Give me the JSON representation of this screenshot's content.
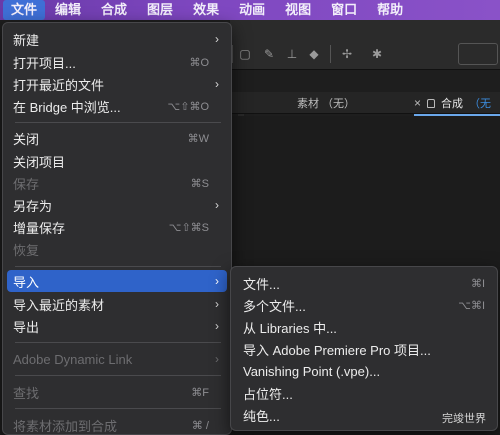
{
  "menubar": {
    "items": [
      "文件",
      "编辑",
      "合成",
      "图层",
      "效果",
      "动画",
      "视图",
      "窗口",
      "帮助"
    ]
  },
  "panel": {
    "project_tab": "素材 （无）",
    "comp_close": "×",
    "comp_label": "合成",
    "comp_value": "（无"
  },
  "file_menu": {
    "items": [
      {
        "label": "新建",
        "shortcut": "",
        "arrow": "›",
        "disabled": false
      },
      {
        "label": "打开项目...",
        "shortcut": "⌘O",
        "arrow": "",
        "disabled": false
      },
      {
        "label": "打开最近的文件",
        "shortcut": "",
        "arrow": "›",
        "disabled": false
      },
      {
        "label": "在 Bridge 中浏览...",
        "shortcut": "⌥⇧⌘O",
        "arrow": "",
        "disabled": false
      },
      {
        "label": "关闭",
        "shortcut": "⌘W",
        "arrow": "",
        "disabled": false
      },
      {
        "label": "关闭项目",
        "shortcut": "",
        "arrow": "",
        "disabled": false
      },
      {
        "label": "保存",
        "shortcut": "⌘S",
        "arrow": "",
        "disabled": true
      },
      {
        "label": "另存为",
        "shortcut": "",
        "arrow": "›",
        "disabled": false
      },
      {
        "label": "增量保存",
        "shortcut": "⌥⇧⌘S",
        "arrow": "",
        "disabled": false
      },
      {
        "label": "恢复",
        "shortcut": "",
        "arrow": "",
        "disabled": true
      },
      {
        "label": "导入",
        "shortcut": "",
        "arrow": "›",
        "disabled": false
      },
      {
        "label": "导入最近的素材",
        "shortcut": "",
        "arrow": "›",
        "disabled": false
      },
      {
        "label": "导出",
        "shortcut": "",
        "arrow": "›",
        "disabled": false
      },
      {
        "label": "Adobe Dynamic Link",
        "shortcut": "",
        "arrow": "›",
        "disabled": true
      },
      {
        "label": "查找",
        "shortcut": "⌘F",
        "arrow": "",
        "disabled": true
      },
      {
        "label": "将素材添加到合成",
        "shortcut": "⌘ /",
        "arrow": "",
        "disabled": true
      }
    ]
  },
  "import_submenu": {
    "items": [
      {
        "label": "文件...",
        "shortcut": "⌘I"
      },
      {
        "label": "多个文件...",
        "shortcut": "⌥⌘I"
      },
      {
        "label": "从 Libraries 中...",
        "shortcut": ""
      },
      {
        "label": "导入 Adobe Premiere Pro 项目...",
        "shortcut": ""
      },
      {
        "label": "Vanishing Point (.vpe)...",
        "shortcut": ""
      },
      {
        "label": "占位符...",
        "shortcut": ""
      },
      {
        "label": "纯色...",
        "shortcut": ""
      }
    ]
  },
  "watermark": "完竣世界",
  "colors": {
    "menubar": "#7e47c0",
    "highlight": "#2f63c9",
    "menu_bg": "#2e2e30",
    "accent": "#3b8de0"
  }
}
